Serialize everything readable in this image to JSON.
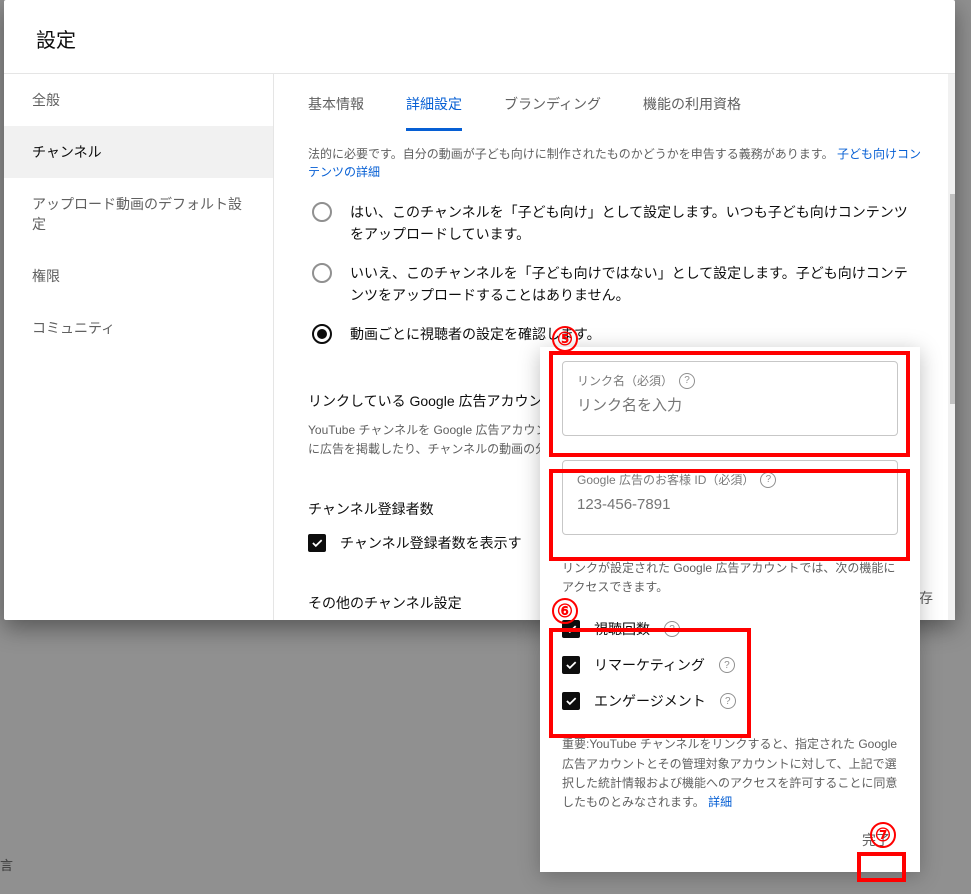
{
  "header": {
    "title": "設定"
  },
  "sidebar": {
    "items": [
      {
        "label": "全般"
      },
      {
        "label": "チャンネル"
      },
      {
        "label": "アップロード動画のデフォルト設定"
      },
      {
        "label": "権限"
      },
      {
        "label": "コミュニティ"
      }
    ]
  },
  "tabs": [
    {
      "label": "基本情報"
    },
    {
      "label": "詳細設定"
    },
    {
      "label": "ブランディング"
    },
    {
      "label": "機能の利用資格"
    }
  ],
  "audience": {
    "legal_text": "法的に必要です。自分の動画が子ども向けに制作されたものかどうかを申告する義務があります。",
    "legal_link": "子ども向けコンテンツの詳細",
    "options": [
      "はい、このチャンネルを「子ども向け」として設定します。いつも子ども向けコンテンツをアップロードしています。",
      "いいえ、このチャンネルを「子ども向けではない」として設定します。子ども向けコンテンツをアップロードすることはありません。",
      "動画ごとに視聴者の設定を確認します。"
    ]
  },
  "google_ads_section": {
    "title": "リンクしている Google 広告アカウント",
    "desc": "YouTube チャンネルを Google 広告アカウントにリンクすると、リンクされた Google 広告アカウントで動画を元に広告を掲載したり、チャンネルの動画の分析情報"
  },
  "subscriber_section": {
    "title": "チャンネル登録者数",
    "checkbox_label": "チャンネル登録者数を表示す"
  },
  "other_section": {
    "title": "その他のチャンネル設定"
  },
  "popup": {
    "link_name": {
      "label": "リンク名（必須）",
      "placeholder": "リンク名を入力"
    },
    "customer_id": {
      "label": "Google 広告のお客様 ID（必須）",
      "placeholder": "123-456-7891"
    },
    "features_desc": "リンクが設定された Google 広告アカウントでは、次の機能にアクセスできます。",
    "features": [
      {
        "label": "視聴回数"
      },
      {
        "label": "リマーケティング"
      },
      {
        "label": "エンゲージメント"
      }
    ],
    "note_text": "重要:YouTube チャンネルをリンクすると、指定された Google 広告アカウントとその管理対象アカウントに対して、上記で選択した統計情報および機能へのアクセスを許可することに同意したものとみなされます。",
    "note_link": "詳細",
    "done": "完了"
  },
  "footer": {
    "save": "保存"
  },
  "annotations": {
    "a5": "⑤",
    "a6": "⑥",
    "a7": "⑦"
  },
  "bottom_truncated": "言"
}
